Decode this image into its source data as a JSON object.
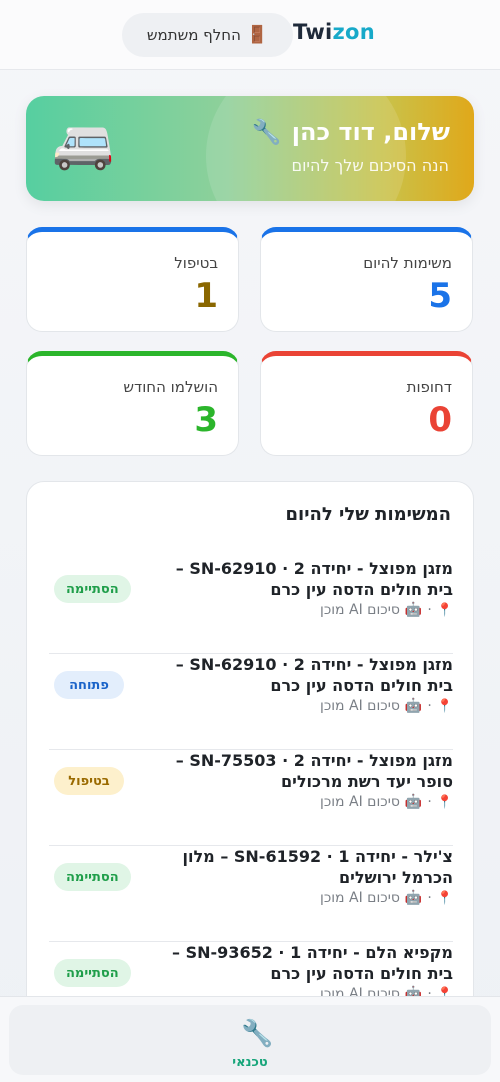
{
  "header": {
    "brand_part1": "Twi",
    "brand_part2": "zon",
    "switch_user_label": "החלף משתמש",
    "switch_user_icon": "door-icon"
  },
  "hero": {
    "title": "שלום, דוד כהן",
    "title_icon": "wrench-icon",
    "subtitle": "הנה הסיכום שלך להיום",
    "vehicle_icon": "van-icon"
  },
  "stats": [
    {
      "label": "משימות להיום",
      "value": "5",
      "color": "#1a73e8"
    },
    {
      "label": "בטיפול",
      "value": "1",
      "color": "#8a6700"
    },
    {
      "label": "דחופות",
      "value": "0",
      "color": "#ea4335"
    },
    {
      "label": "הושלמו החודש",
      "value": "3",
      "color": "#2bb52b"
    }
  ],
  "tasks_panel": {
    "title": "המשימות שלי להיום",
    "ai_summary_label": "סיכום AI מוכן",
    "tasks": [
      {
        "title": "מזגן מפוצל - יחידה 2 · SN-62910 – בית חולים הדסה עין כרם",
        "status": "הסתיימה"
      },
      {
        "title": "מזגן מפוצל - יחידה 2 · SN-62910 – בית חולים הדסה עין כרם",
        "status": "פתוחה"
      },
      {
        "title": "מזגן מפוצל - יחידה 2 · SN-75503 – סופר יעד רשת מרכולים",
        "status": "בטיפול"
      },
      {
        "title": "צ'ילר - יחידה 1 · SN-61592 – מלון הכרמל ירושלים",
        "status": "הסתיימה"
      },
      {
        "title": "מקפיא הלם - יחידה 1 · SN-93652 – בית חולים הדסה עין כרם",
        "status": "הסתיימה"
      }
    ]
  },
  "bottom_nav": {
    "tab_label": "טכנאי",
    "tab_icon": "wrench-icon"
  }
}
